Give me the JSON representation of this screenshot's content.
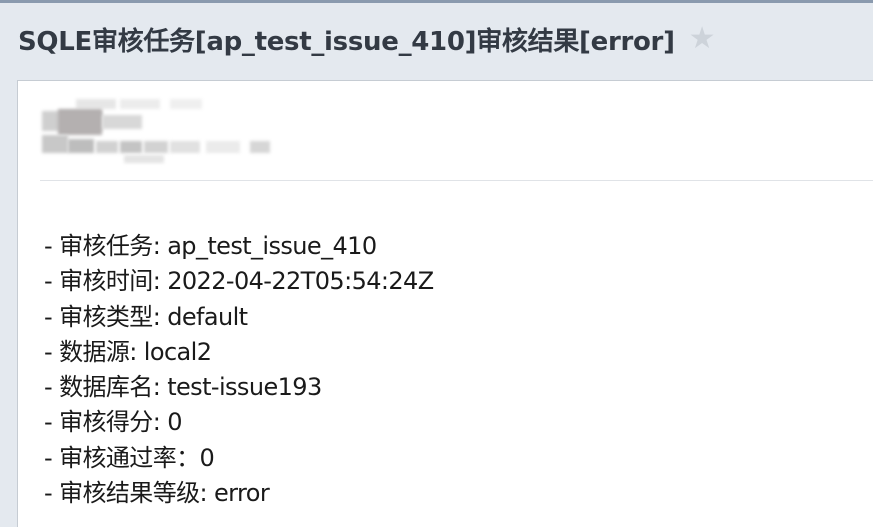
{
  "email": {
    "subject": "SQLE审核任务[ap_test_issue_410]审核结果[error]",
    "star_icon": "star-icon",
    "lines": [
      "- 审核任务: ap_test_issue_410",
      "- 审核时间: 2022-04-22T05:54:24Z",
      "- 审核类型: default",
      "- 数据源: local2",
      "- 数据库名: test-issue193",
      "- 审核得分: 0",
      "- 审核通过率：0",
      "- 审核结果等级: error"
    ]
  },
  "colors": {
    "background": "#e4e9ef",
    "subject_text": "#333a44",
    "star": "#cdd3da",
    "body_background": "#ffffff"
  }
}
